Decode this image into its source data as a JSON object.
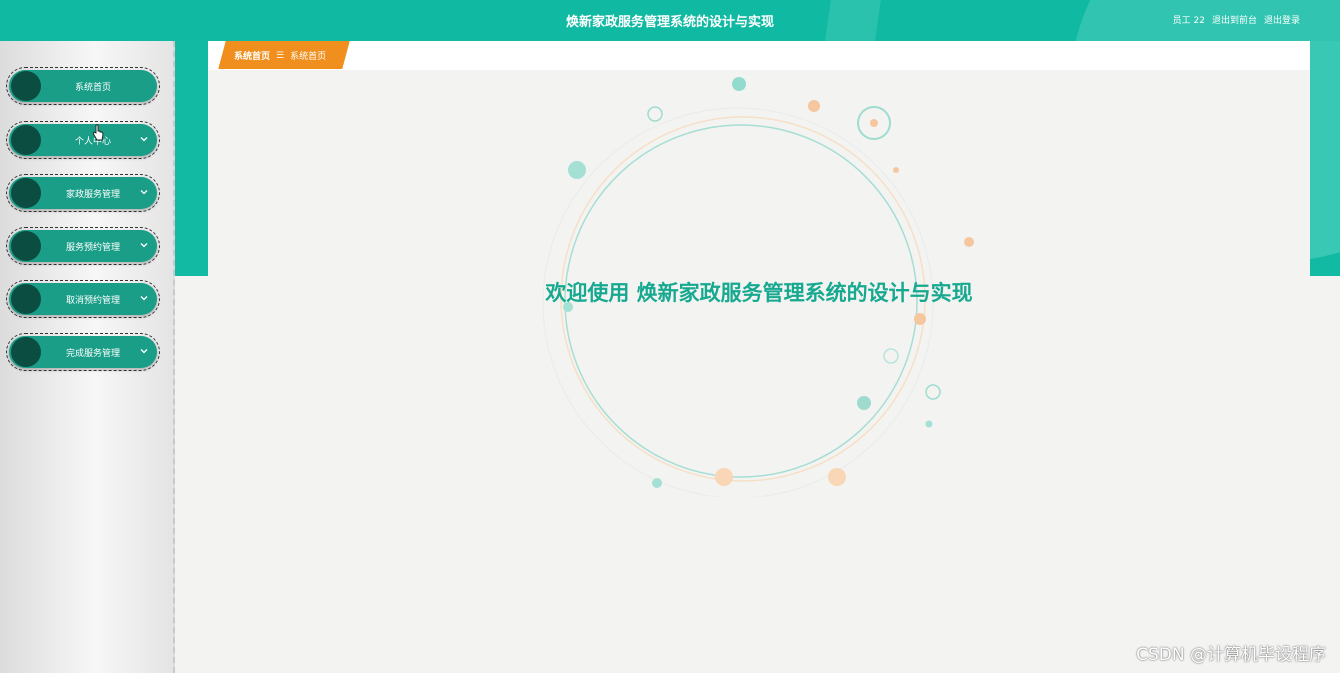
{
  "header": {
    "title": "焕新家政服务管理系统的设计与实现",
    "user_label": "员工 22",
    "back_label": "退出到前台",
    "logout_label": "退出登录"
  },
  "sidebar": {
    "items": [
      {
        "label": "系统首页",
        "has_chevron": false
      },
      {
        "label": "个人中心",
        "has_chevron": true
      },
      {
        "label": "家政服务管理",
        "has_chevron": true
      },
      {
        "label": "服务预约管理",
        "has_chevron": true
      },
      {
        "label": "取消预约管理",
        "has_chevron": true
      },
      {
        "label": "完成服务管理",
        "has_chevron": true
      }
    ]
  },
  "breadcrumb": {
    "home_label": "系统首页",
    "separator": "☰",
    "current_label": "系统首页"
  },
  "main": {
    "welcome_text": "欢迎使用 焕新家政服务管理系统的设计与实现"
  },
  "watermark": "CSDN @计算机毕设程序",
  "colors": {
    "primary": "#0fb9a2",
    "menu": "#1a9e88",
    "knob": "#0b4d40",
    "accent": "#f08f1d",
    "welcome": "#17a990"
  }
}
